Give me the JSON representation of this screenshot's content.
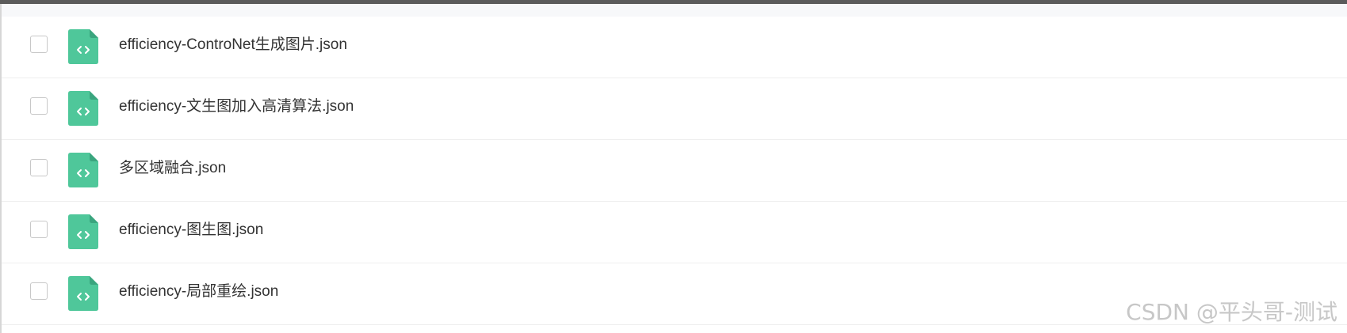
{
  "files": [
    {
      "name": "efficiency-ControNet生成图片.json",
      "icon": "code-file-icon",
      "checked": false
    },
    {
      "name": "efficiency-文生图加入高清算法.json",
      "icon": "code-file-icon",
      "checked": false
    },
    {
      "name": "多区域融合.json",
      "icon": "code-file-icon",
      "checked": false
    },
    {
      "name": "efficiency-图生图.json",
      "icon": "code-file-icon",
      "checked": false
    },
    {
      "name": "efficiency-局部重绘.json",
      "icon": "code-file-icon",
      "checked": false
    }
  ],
  "watermark": "CSDN @平头哥-测试",
  "colors": {
    "icon_green": "#4fc79a",
    "top_bar": "#5b5b5b",
    "text": "#333333"
  }
}
